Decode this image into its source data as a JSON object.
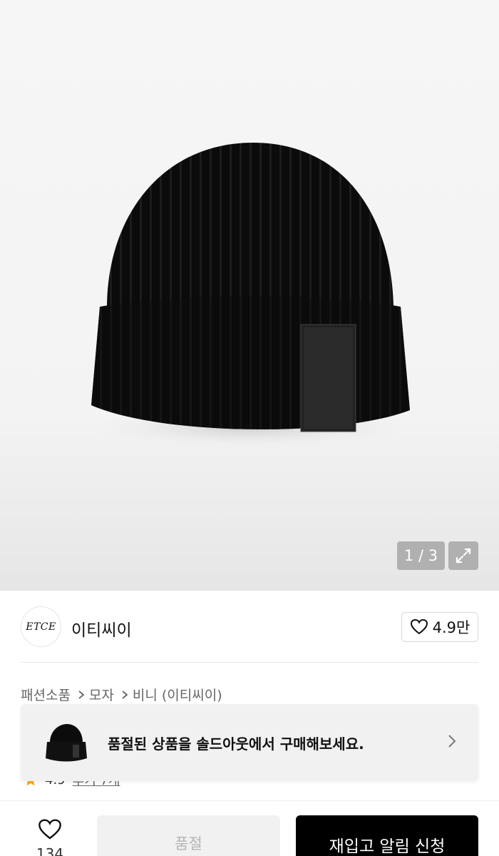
{
  "gallery": {
    "current": "1 / 3",
    "image_icon": "beanie-image",
    "expand_icon": "expand-icon"
  },
  "brand": {
    "logo_text": "ETCE",
    "name": "이티씨이",
    "likes": "4.9만",
    "like_icon": "heart-outline-icon"
  },
  "breadcrumb": {
    "items": [
      "패션소품",
      "모자",
      "비니 (이티씨이)"
    ],
    "separator_icon": "chevron-right-icon"
  },
  "rating": {
    "value": "4.9",
    "link": "후기 7개",
    "star_color": "#f5a623"
  },
  "soldout_banner": {
    "text": "품절된 상품을 솔드아웃에서 구매해보세요.",
    "chevron_icon": "chevron-right-icon"
  },
  "bottom_bar": {
    "wish_count": "134",
    "soldout_label": "품절",
    "restock_label": "재입고 알림 신청"
  },
  "colors": {
    "primary": "#000000",
    "disabled_bg": "#f1f1f1",
    "disabled_text": "#b3b3b3"
  }
}
